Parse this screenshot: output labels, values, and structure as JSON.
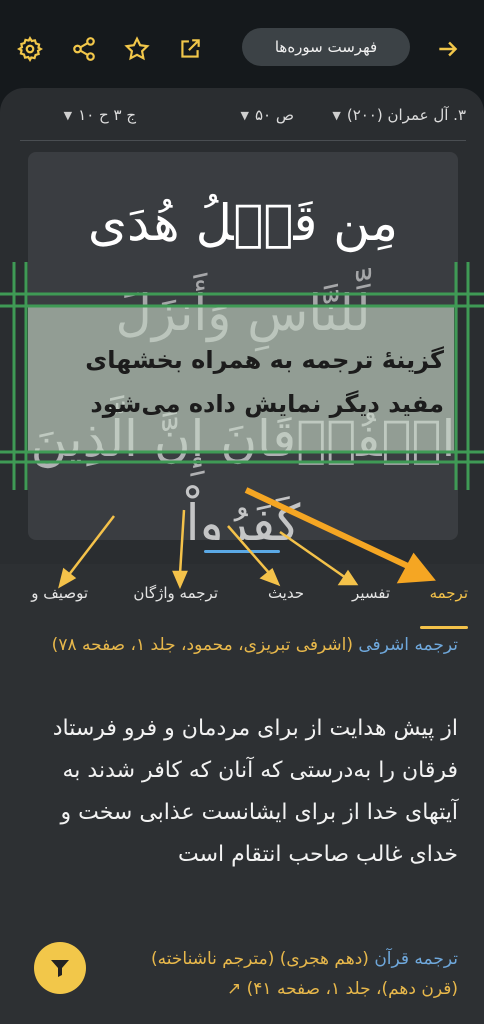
{
  "header": {
    "surah_list_label": "فهرست سوره‌ها"
  },
  "selectors": {
    "surah": "۳. آل عمران (۲۰۰)",
    "page": "ص ۵۰",
    "juz": "ج ۳ ح ۱۰"
  },
  "quran_text": {
    "line1": "مِن قَبۡلُ هُدَى",
    "line2": "لِّلنَّاسِ وَأَنزَلَ",
    "line3": "الۡفُرۡقَانَ إِنَّ الَّذِينَ",
    "line4": "كَفَرُواْ"
  },
  "overlay_note": "گزینهٔ ترجمه به همراه بخشهای مفید دیگر نمایش داده می‌شود",
  "tabs": [
    "ترجمه",
    "تفسیر",
    "حدیث",
    "ترجمه واژگان",
    "توصیف و"
  ],
  "translation": {
    "source_name": "ترجمه اشرفی",
    "source_meta": "(اشرفی تبریزی، محمود، جلد ۱، صفحه ۷۸)",
    "text": "از پیش هدایت از برای مردمان و فرو فرستاد فرقان را به‌درستی که آنان که کافر شدند به آیتهای خدا از برای ایشانست عذابی سخت و خدای غالب صاحب انتقام است",
    "second_source_name": "ترجمه قرآن",
    "second_source_meta": "(دهم هجری) (مترجم ناشناخته)",
    "second_source_detail": "(قرن دهم)، جلد ۱، صفحه ۴۱)"
  },
  "colors": {
    "accent": "#f4c24a",
    "link": "#6fa8dc",
    "background": "#15191c"
  }
}
